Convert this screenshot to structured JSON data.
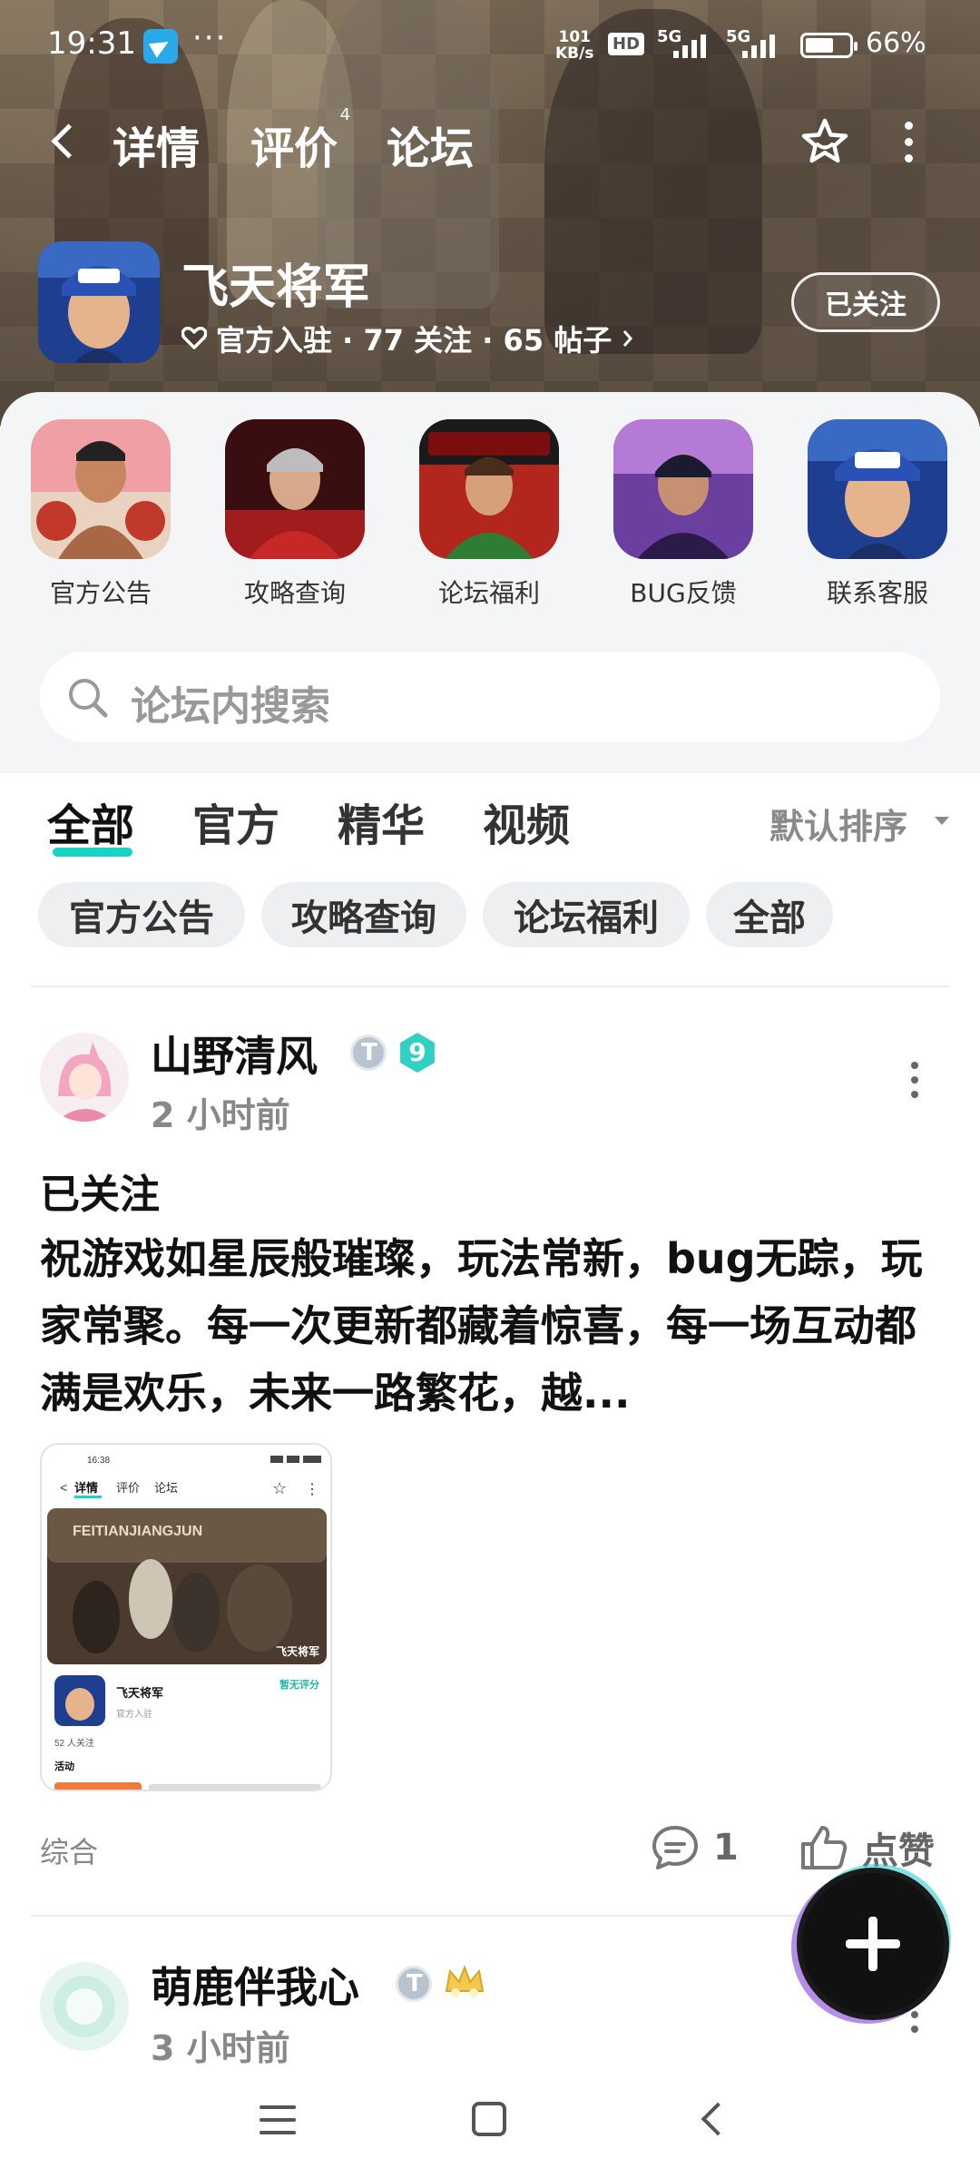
{
  "status_bar": {
    "time": "19:31",
    "more": "···",
    "net_speed_value": "101",
    "net_speed_unit": "KB/s",
    "hd": "HD",
    "sig1": "5G",
    "sig2": "5G",
    "battery": "66%"
  },
  "top_nav": {
    "tabs": [
      {
        "label": "详情"
      },
      {
        "label": "评价",
        "badge": "4"
      },
      {
        "label": "论坛"
      }
    ]
  },
  "game": {
    "name": "飞天将军",
    "meta": "官方入驻 · 77 关注 · 65 帖子",
    "follow_label": "已关注"
  },
  "shortcuts": [
    {
      "label": "官方公告"
    },
    {
      "label": "攻略查询"
    },
    {
      "label": "论坛福利"
    },
    {
      "label": "BUG反馈"
    },
    {
      "label": "联系客服"
    }
  ],
  "search": {
    "placeholder": "论坛内搜索"
  },
  "filter_tabs": [
    {
      "label": "全部"
    },
    {
      "label": "官方"
    },
    {
      "label": "精华"
    },
    {
      "label": "视频"
    }
  ],
  "sort_label": "默认排序",
  "chips": [
    {
      "label": "官方公告"
    },
    {
      "label": "攻略查询"
    },
    {
      "label": "论坛福利"
    },
    {
      "label": "全部"
    }
  ],
  "posts": [
    {
      "user": "山野清风",
      "level": "9",
      "time": "2 小时前",
      "tag": "已关注",
      "body": "祝游戏如星辰般璀璨，玩法常新，bug无踪，玩家常聚。每一次更新都藏着惊喜，每一场互动都满是欢乐，未来一路繁花，越...",
      "category": "综合",
      "comments": "1",
      "like_label": "点赞",
      "thumb": {
        "time": "16:38",
        "tabs": [
          "详情",
          "评价",
          "论坛"
        ],
        "banner_text": "FEITIANJIANGJUN",
        "logo": "飞天将军",
        "game_name": "飞天将军",
        "official": "官方入驻",
        "no_rating": "暂无评分",
        "followers": "52 人关注",
        "activity": "活动"
      }
    },
    {
      "user": "萌鹿伴我心",
      "time": "3 小时前"
    }
  ]
}
